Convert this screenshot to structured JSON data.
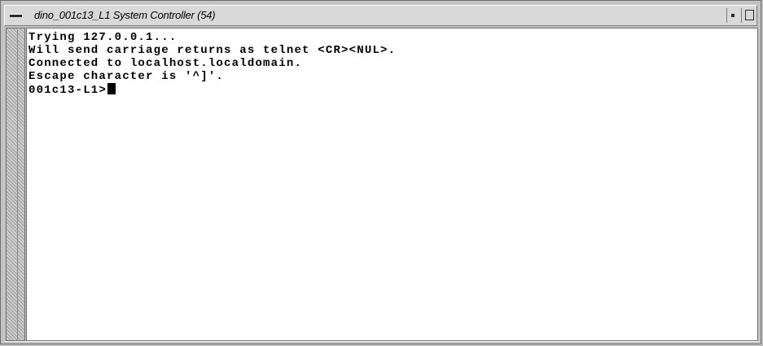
{
  "window": {
    "title": "dino_001c13_L1 System Controller (54)"
  },
  "terminal": {
    "lines": [
      "Trying 127.0.0.1...",
      "Will send carriage returns as telnet <CR><NUL>.",
      "Connected to localhost.localdomain.",
      "Escape character is '^]'."
    ],
    "prompt": "001c13-L1>"
  },
  "icons": {
    "window_menu": "window-menu-icon",
    "minimize": "minimize-icon",
    "maximize": "maximize-icon"
  },
  "colors": {
    "terminal_background": "#ffffff",
    "terminal_text": "#000000",
    "frame": "#c3c3c3"
  }
}
